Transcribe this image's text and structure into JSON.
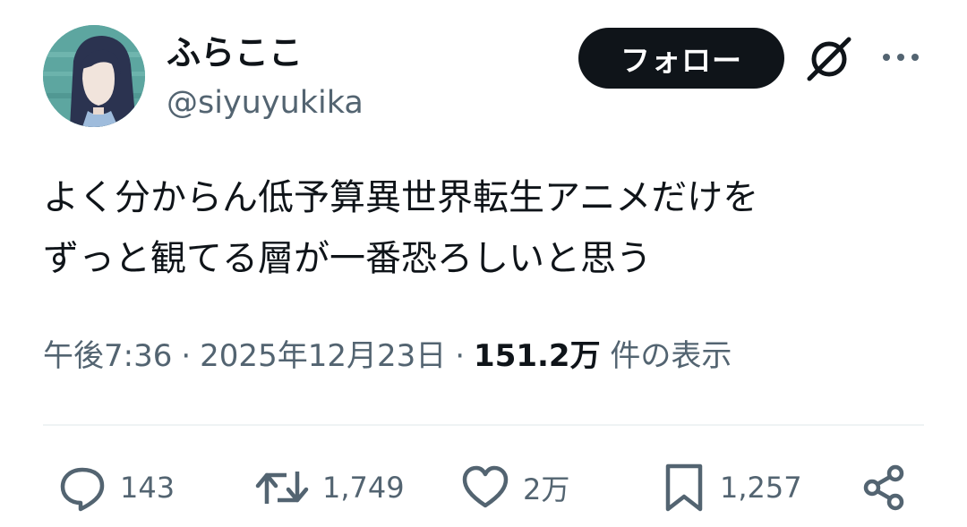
{
  "user": {
    "display_name": "ふらここ",
    "handle": "@siyuyukika",
    "avatar_icon": "anime-girl-avatar"
  },
  "header": {
    "follow_label": "フォロー",
    "grok_icon": "grok-icon",
    "more_icon": "more-horizontal-icon"
  },
  "tweet": {
    "lines": [
      "よく分からん低予算異世界転生アニメだけを",
      "ずっと観てる層が一番恐ろしいと思う"
    ]
  },
  "meta": {
    "time": "午後7:36",
    "separator": "·",
    "date": "2025年12月23日",
    "views_count": "151.2万",
    "views_label": "件の表示"
  },
  "actions": {
    "reply": {
      "icon": "reply-icon",
      "count": "143"
    },
    "repost": {
      "icon": "repost-icon",
      "count": "1,749"
    },
    "like": {
      "icon": "heart-icon",
      "count": "2万"
    },
    "bookmark": {
      "icon": "bookmark-icon",
      "count": "1,257"
    },
    "share": {
      "icon": "share-icon"
    }
  },
  "colors": {
    "text_primary": "#0f1419",
    "text_secondary": "#536471",
    "follow_bg": "#0f1419",
    "divider": "#eff3f4"
  }
}
